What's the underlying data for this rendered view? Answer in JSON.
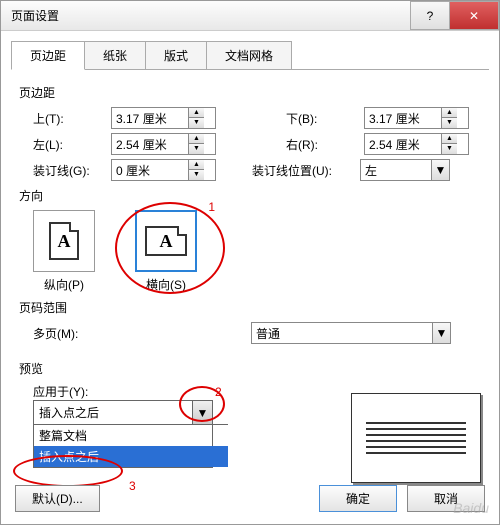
{
  "title": "页面设置",
  "tabs": [
    "页边距",
    "纸张",
    "版式",
    "文档网格"
  ],
  "margins": {
    "section": "页边距",
    "top_label": "上(T):",
    "top_value": "3.17 厘米",
    "bottom_label": "下(B):",
    "bottom_value": "3.17 厘米",
    "left_label": "左(L):",
    "left_value": "2.54 厘米",
    "right_label": "右(R):",
    "right_value": "2.54 厘米",
    "gutter_label": "装订线(G):",
    "gutter_value": "0 厘米",
    "gutter_pos_label": "装订线位置(U):",
    "gutter_pos_value": "左"
  },
  "orientation": {
    "section": "方向",
    "portrait": "纵向(P)",
    "landscape": "横向(S)",
    "icon_letter": "A"
  },
  "pages": {
    "section": "页码范围",
    "multi_label": "多页(M):",
    "multi_value": "普通"
  },
  "preview": {
    "section": "预览",
    "apply_label": "应用于(Y):",
    "selected": "插入点之后",
    "options": [
      "整篇文档",
      "插入点之后"
    ]
  },
  "annotations": {
    "a1": "1",
    "a2": "2",
    "a3": "3"
  },
  "buttons": {
    "default": "默认(D)...",
    "ok": "确定",
    "cancel": "取消"
  },
  "glyphs": {
    "up": "▲",
    "down": "▼",
    "q": "?",
    "x": "✕"
  }
}
